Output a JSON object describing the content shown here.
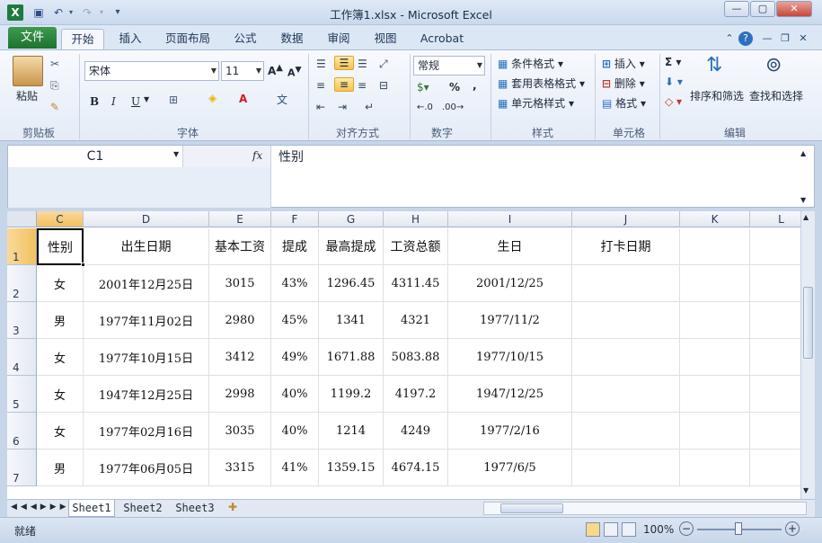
{
  "window": {
    "title": "工作簿1.xlsx - Microsoft Excel",
    "logo": "X",
    "qa_icons": [
      "save-icon",
      "undo-icon",
      "redo-icon",
      "customize-icon"
    ]
  },
  "tabs": [
    "文件",
    "开始",
    "插入",
    "页面布局",
    "公式",
    "数据",
    "审阅",
    "视图",
    "Acrobat"
  ],
  "ribbon": {
    "clipboard": {
      "paste": "粘贴",
      "label": "剪贴板"
    },
    "font": {
      "name": "宋体",
      "size": "11",
      "bold": "B",
      "italic": "I",
      "underline": "U",
      "label": "字体"
    },
    "alignment": {
      "label": "对齐方式"
    },
    "number": {
      "format": "常规",
      "percent": "%",
      "comma": ",",
      "label": "数字"
    },
    "styles": {
      "conditional": "条件格式",
      "table": "套用表格格式",
      "cell": "单元格样式",
      "label": "样式"
    },
    "cells": {
      "insert": "插入",
      "delete": "删除",
      "format": "格式",
      "label": "单元格"
    },
    "editing": {
      "sort": "排序和筛选",
      "find": "查找和选择",
      "label": "编辑"
    }
  },
  "formula_bar": {
    "name_box": "C1",
    "fx": "fx",
    "content": "性别"
  },
  "grid": {
    "columns": [
      "C",
      "D",
      "E",
      "F",
      "G",
      "H",
      "I",
      "J",
      "K",
      "L"
    ],
    "rows": [
      {
        "num": "1",
        "cells": [
          "性别",
          "出生日期",
          "基本工资",
          "提成",
          "最高提成",
          "工资总额",
          "生日",
          "打卡日期",
          "",
          ""
        ]
      },
      {
        "num": "2",
        "cells": [
          "女",
          "2001年12月25日",
          "3015",
          "43%",
          "1296.45",
          "4311.45",
          "2001/12/25",
          "",
          "",
          ""
        ]
      },
      {
        "num": "3",
        "cells": [
          "男",
          "1977年11月02日",
          "2980",
          "45%",
          "1341",
          "4321",
          "1977/11/2",
          "",
          "",
          ""
        ]
      },
      {
        "num": "4",
        "cells": [
          "女",
          "1977年10月15日",
          "3412",
          "49%",
          "1671.88",
          "5083.88",
          "1977/10/15",
          "",
          "",
          ""
        ]
      },
      {
        "num": "5",
        "cells": [
          "女",
          "1947年12月25日",
          "2998",
          "40%",
          "1199.2",
          "4197.2",
          "1947/12/25",
          "",
          "",
          ""
        ]
      },
      {
        "num": "6",
        "cells": [
          "女",
          "1977年02月16日",
          "3035",
          "40%",
          "1214",
          "4249",
          "1977/2/16",
          "",
          "",
          ""
        ]
      },
      {
        "num": "7",
        "cells": [
          "男",
          "1977年06月05日",
          "3315",
          "41%",
          "1359.15",
          "4674.15",
          "1977/6/5",
          "",
          "",
          ""
        ]
      }
    ]
  },
  "sheets": [
    "Sheet1",
    "Sheet2",
    "Sheet3"
  ],
  "status": {
    "ready": "就绪",
    "zoom": "100%"
  }
}
